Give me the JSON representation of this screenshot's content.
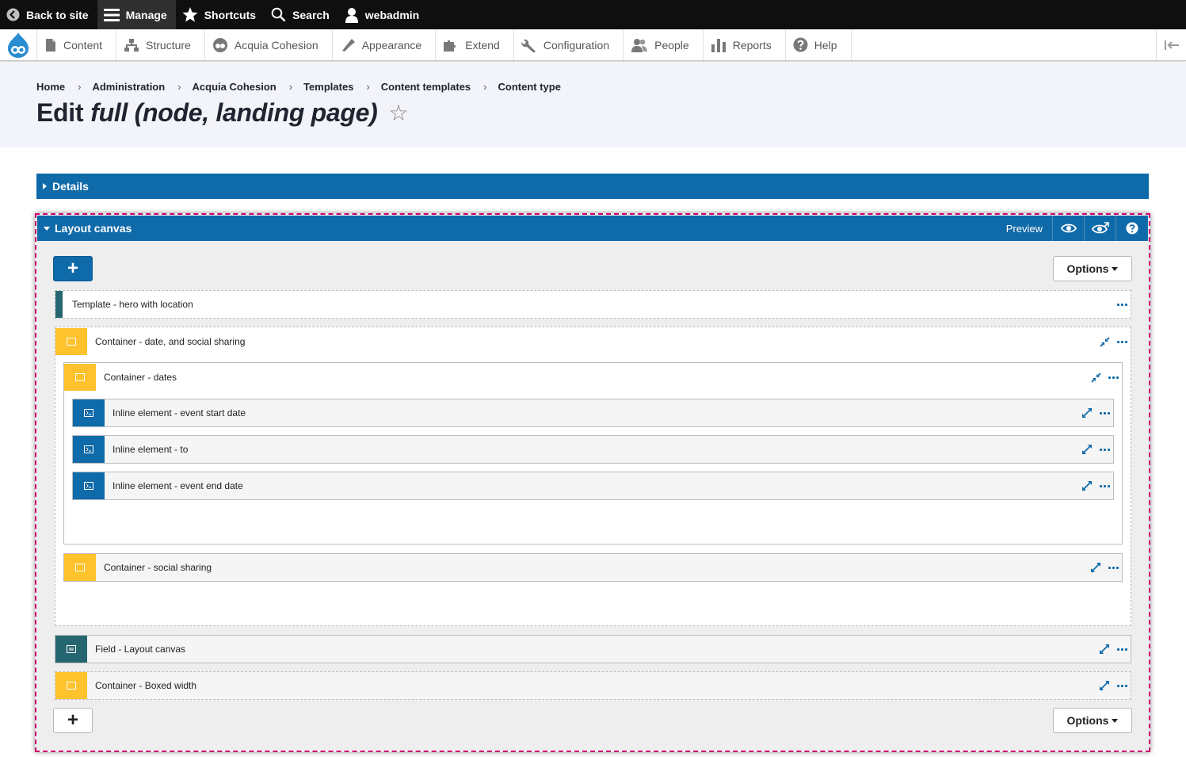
{
  "toolbar": {
    "back_label": "Back to site",
    "manage_label": "Manage",
    "shortcuts_label": "Shortcuts",
    "search_label": "Search",
    "user_label": "webadmin"
  },
  "tray": {
    "items": [
      {
        "label": "Content",
        "icon": "file-icon"
      },
      {
        "label": "Structure",
        "icon": "structure-icon"
      },
      {
        "label": "Acquia Cohesion",
        "icon": "cohesion-icon"
      },
      {
        "label": "Appearance",
        "icon": "brush-icon"
      },
      {
        "label": "Extend",
        "icon": "puzzle-icon"
      },
      {
        "label": "Configuration",
        "icon": "wrench-icon"
      },
      {
        "label": "People",
        "icon": "people-icon"
      },
      {
        "label": "Reports",
        "icon": "chart-icon"
      },
      {
        "label": "Help",
        "icon": "help-icon"
      }
    ]
  },
  "breadcrumb": [
    "Home",
    "Administration",
    "Acquia Cohesion",
    "Templates",
    "Content templates",
    "Content type"
  ],
  "title": {
    "prefix": "Edit",
    "emphasis": "full (node, landing page)",
    "star": "☆"
  },
  "details": {
    "label": "Details"
  },
  "canvas": {
    "title": "Layout canvas",
    "preview_label": "Preview",
    "add_label": "+",
    "options_label": "Options",
    "rows": {
      "template_hero": "Template - hero with location",
      "container_date_social": "Container - date, and social sharing",
      "container_dates": "Container - dates",
      "inline_start": "Inline element - event start date",
      "inline_to": "Inline element - to",
      "inline_end": "Inline element - event end date",
      "container_social": "Container - social sharing",
      "field_layout": "Field - Layout canvas",
      "container_boxed": "Container - Boxed width"
    }
  },
  "colors": {
    "primary": "#0f6aa9",
    "container": "#fdc22c",
    "template": "#266671",
    "canvas_outline": "#d0006f"
  }
}
